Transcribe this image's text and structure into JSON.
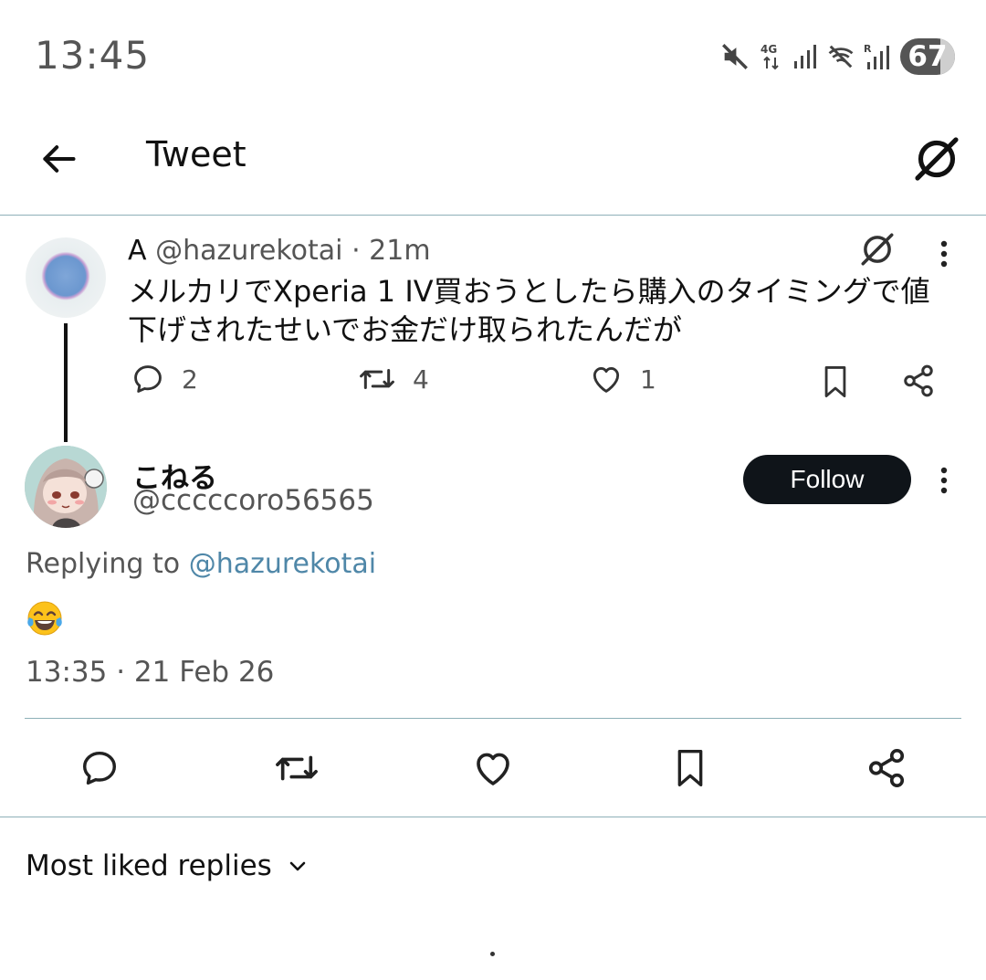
{
  "status_bar": {
    "time": "13:45",
    "network": "4G",
    "battery": "67",
    "icons": [
      "mute-icon",
      "signal-icon",
      "wifi-off-icon",
      "roaming-signal-icon",
      "battery-icon"
    ]
  },
  "header": {
    "title": "Tweet",
    "icons": [
      "back-arrow-icon",
      "no-entry-icon"
    ]
  },
  "parent_tweet": {
    "name": "A",
    "handle": "@hazurekotai",
    "age": "21m",
    "text": "メルカリでXperia 1 IV買おうとしたら購入のタイミングで値下げされたせいでお金だけ取られたんだが",
    "replies": "2",
    "retweets": "4",
    "likes": "1"
  },
  "reply_tweet": {
    "name": "こねる",
    "handle": "@cccccoro56565",
    "follow_label": "Follow",
    "replying_prefix": "Replying to",
    "replying_to": "@hazurekotai",
    "content": "😂",
    "timestamp": "13:35 · 21 Feb 26"
  },
  "replies_filter": {
    "label": "Most liked replies"
  },
  "colors": {
    "accent_link": "#4f87a8",
    "follow_button": "#0f1419",
    "divider": "#8eb0b8"
  }
}
